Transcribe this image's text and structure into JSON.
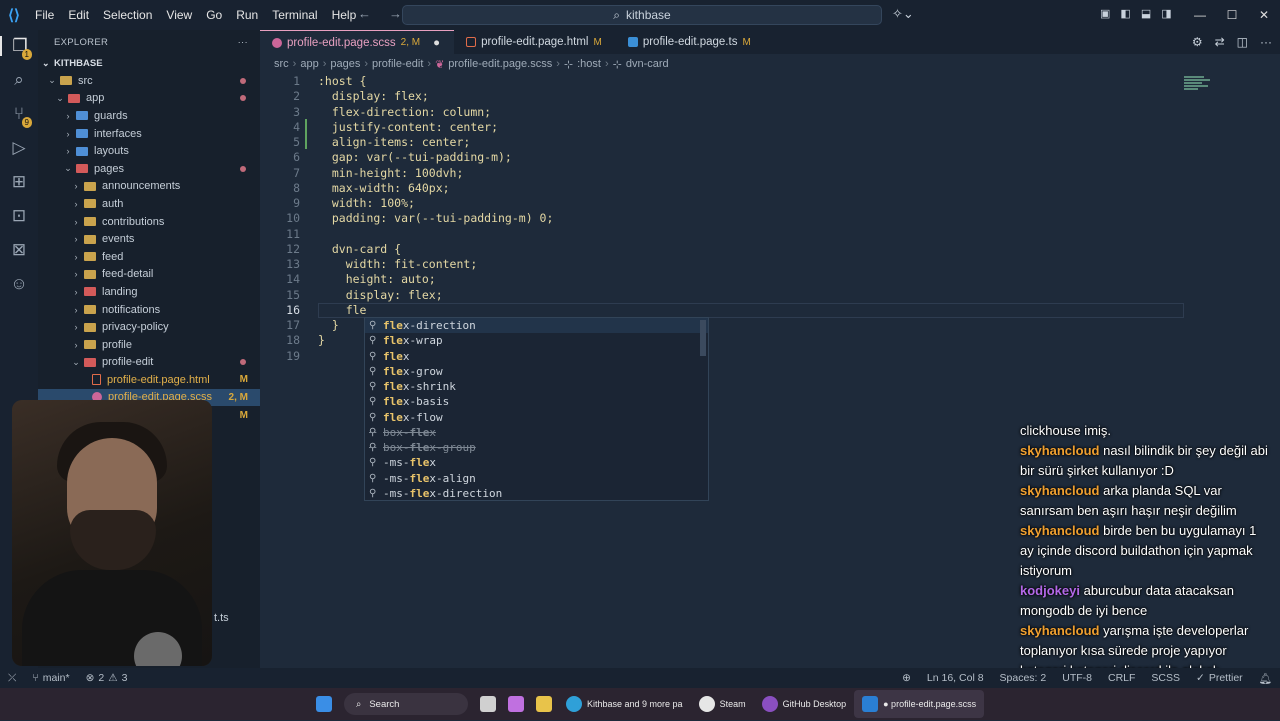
{
  "titlebar": {
    "menus": [
      "File",
      "Edit",
      "Selection",
      "View",
      "Go",
      "Run",
      "Terminal",
      "Help"
    ],
    "search": "kithbase",
    "window_controls": [
      "—",
      "☐",
      "✕"
    ]
  },
  "sidebar": {
    "header": "EXPLORER",
    "project": "KITHBASE",
    "items": [
      {
        "label": "src",
        "indent": 0,
        "open": true,
        "icon": "folder-green",
        "mark": "dot"
      },
      {
        "label": "app",
        "indent": 1,
        "open": true,
        "icon": "folder-red",
        "mark": "dot"
      },
      {
        "label": "guards",
        "indent": 2,
        "open": false,
        "icon": "folder-blue",
        "mark": ""
      },
      {
        "label": "interfaces",
        "indent": 2,
        "open": false,
        "icon": "folder-blue",
        "mark": ""
      },
      {
        "label": "layouts",
        "indent": 2,
        "open": false,
        "icon": "folder-blue",
        "mark": ""
      },
      {
        "label": "pages",
        "indent": 2,
        "open": true,
        "icon": "folder-red",
        "mark": "dot"
      },
      {
        "label": "announcements",
        "indent": 3,
        "open": false,
        "icon": "folder",
        "mark": ""
      },
      {
        "label": "auth",
        "indent": 3,
        "open": false,
        "icon": "folder",
        "mark": ""
      },
      {
        "label": "contributions",
        "indent": 3,
        "open": false,
        "icon": "folder",
        "mark": ""
      },
      {
        "label": "events",
        "indent": 3,
        "open": false,
        "icon": "folder",
        "mark": ""
      },
      {
        "label": "feed",
        "indent": 3,
        "open": false,
        "icon": "folder",
        "mark": ""
      },
      {
        "label": "feed-detail",
        "indent": 3,
        "open": false,
        "icon": "folder",
        "mark": ""
      },
      {
        "label": "landing",
        "indent": 3,
        "open": false,
        "icon": "folder-red",
        "mark": ""
      },
      {
        "label": "notifications",
        "indent": 3,
        "open": false,
        "icon": "folder",
        "mark": ""
      },
      {
        "label": "privacy-policy",
        "indent": 3,
        "open": false,
        "icon": "folder",
        "mark": ""
      },
      {
        "label": "profile",
        "indent": 3,
        "open": false,
        "icon": "folder",
        "mark": ""
      },
      {
        "label": "profile-edit",
        "indent": 3,
        "open": true,
        "icon": "folder-red",
        "mark": "dot"
      },
      {
        "label": "profile-edit.page.html",
        "indent": 4,
        "open": null,
        "icon": "file-html",
        "mark": "M"
      },
      {
        "label": "profile-edit.page.scss",
        "indent": 4,
        "open": null,
        "icon": "file-scss",
        "mark": "2, M",
        "selected": true
      },
      {
        "label": "",
        "indent": 4,
        "open": null,
        "icon": "none",
        "mark": "M"
      }
    ],
    "partial_file": "t.ts"
  },
  "tabs": [
    {
      "label": "profile-edit.page.scss",
      "mark": "2, M",
      "active": true,
      "color": "#cc6699"
    },
    {
      "label": "profile-edit.page.html",
      "mark": "M",
      "active": false,
      "color": "#e06c4a"
    },
    {
      "label": "profile-edit.page.ts",
      "mark": "M",
      "active": false,
      "color": "#3b8fd6"
    }
  ],
  "breadcrumb": [
    "src",
    "app",
    "pages",
    "profile-edit",
    "profile-edit.page.scss",
    ":host",
    "dvn-card"
  ],
  "editor": {
    "current_line": 16,
    "lines": [
      ":host {",
      "  display: flex;",
      "  flex-direction: column;",
      "  justify-content: center;",
      "  align-items: center;",
      "  gap: var(--tui-padding-m);",
      "  min-height: 100dvh;",
      "  max-width: 640px;",
      "  width: 100%;",
      "  padding: var(--tui-padding-m) 0;",
      "",
      "  dvn-card {",
      "    width: fit-content;",
      "    height: auto;",
      "    display: flex;",
      "    fle",
      "  }",
      "}",
      ""
    ]
  },
  "suggest": {
    "typed": "fle",
    "items": [
      {
        "pre": "",
        "match": "fle",
        "post": "x-direction",
        "deprecated": false
      },
      {
        "pre": "",
        "match": "fle",
        "post": "x-wrap",
        "deprecated": false
      },
      {
        "pre": "",
        "match": "fle",
        "post": "x",
        "deprecated": false
      },
      {
        "pre": "",
        "match": "fle",
        "post": "x-grow",
        "deprecated": false
      },
      {
        "pre": "",
        "match": "fle",
        "post": "x-shrink",
        "deprecated": false
      },
      {
        "pre": "",
        "match": "fle",
        "post": "x-basis",
        "deprecated": false
      },
      {
        "pre": "",
        "match": "fle",
        "post": "x-flow",
        "deprecated": false
      },
      {
        "pre": "box-",
        "match": "fle",
        "post": "x",
        "deprecated": true
      },
      {
        "pre": "box-",
        "match": "fle",
        "post": "x-group",
        "deprecated": true
      },
      {
        "pre": "-ms-",
        "match": "fle",
        "post": "x",
        "deprecated": false
      },
      {
        "pre": "-ms-",
        "match": "fle",
        "post": "x-align",
        "deprecated": false
      },
      {
        "pre": "-ms-",
        "match": "fle",
        "post": "x-direction",
        "deprecated": false
      }
    ]
  },
  "chat": [
    {
      "user": "",
      "color": "",
      "text": "clickhouse imiş."
    },
    {
      "user": "skyhancloud",
      "color": "#f0a030",
      "text": "nasıl bilindik bir şey değil abi bir sürü şirket kullanıyor :D"
    },
    {
      "user": "skyhancloud",
      "color": "#f0a030",
      "text": "arka planda SQL var sanırsam ben aşırı haşır neşir değilim"
    },
    {
      "user": "skyhancloud",
      "color": "#f0a030",
      "text": "birde ben bu uygulamayı 1 ay içinde discord buildathon için yapmak istiyorum"
    },
    {
      "user": "kodjokeyi",
      "color": "#b368e8",
      "text": "aburcubur data atacaksan mongodb de iyi bence"
    },
    {
      "user": "skyhancloud",
      "color": "#f0a030",
      "text": "yarışma işte developerlar toplanıyor kısa sürede proje yapıyor kategori kategori discord ile alakalı sonrasında projelerini gönderiyolar kazananlara ödül veriyorlar"
    }
  ],
  "statusbar": {
    "branch": "main*",
    "errors": "2",
    "warnings": "3",
    "position": "Ln 16, Col 8",
    "spaces": "Spaces: 2",
    "encoding": "UTF-8",
    "eol": "CRLF",
    "language": "SCSS",
    "formatter": "Prettier"
  },
  "taskbar": {
    "search": "Search",
    "apps": [
      {
        "label": "Kithbase and 9 more pa",
        "color": "#2fa0d8"
      },
      {
        "label": "Steam",
        "color": "#1b2838"
      },
      {
        "label": "GitHub Desktop",
        "color": "#8a4fc0"
      },
      {
        "label": "● profile-edit.page.scss",
        "color": "#2a7fd4",
        "active": true
      }
    ]
  },
  "badges": {
    "git": "9",
    "ext": "1"
  }
}
